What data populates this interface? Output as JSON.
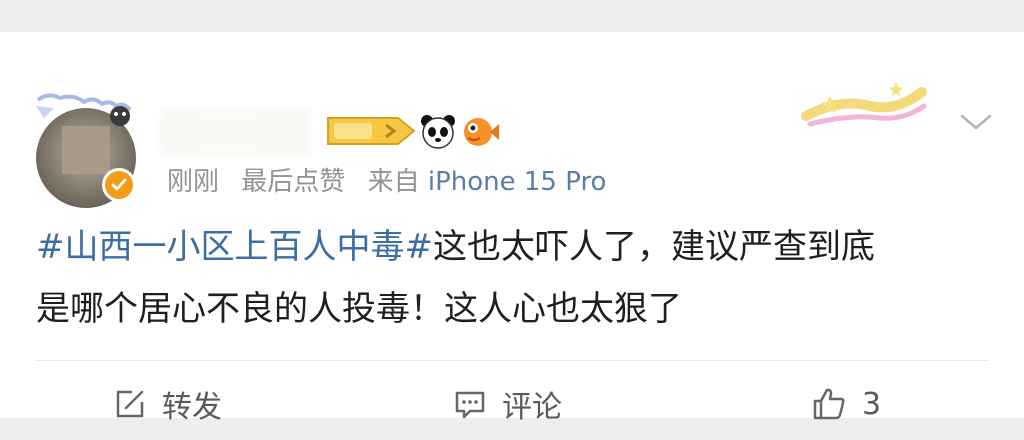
{
  "post": {
    "meta": {
      "time": "刚刚",
      "last_like": "最后点赞",
      "source": "来自",
      "device": "iPhone 15 Pro"
    },
    "text": {
      "hashtag": "#山西一小区上百人中毒#",
      "line1_rest": "这也太吓人了，建议严查到底",
      "line2": "是哪个居心不良的人投毒！这人心也太狠了"
    },
    "actions": {
      "repost_label": "转发",
      "comment_label": "评论",
      "like_count": "3"
    }
  },
  "colors": {
    "hashtag": "#3b6ea5",
    "meta_gray": "#939393",
    "verified_badge": "#f19d1a",
    "level_badge": "#f7c744"
  },
  "icons": [
    "panda-icon",
    "fish-icon",
    "chevron-down-icon",
    "repost-icon",
    "comment-icon",
    "like-icon",
    "verified-icon"
  ]
}
